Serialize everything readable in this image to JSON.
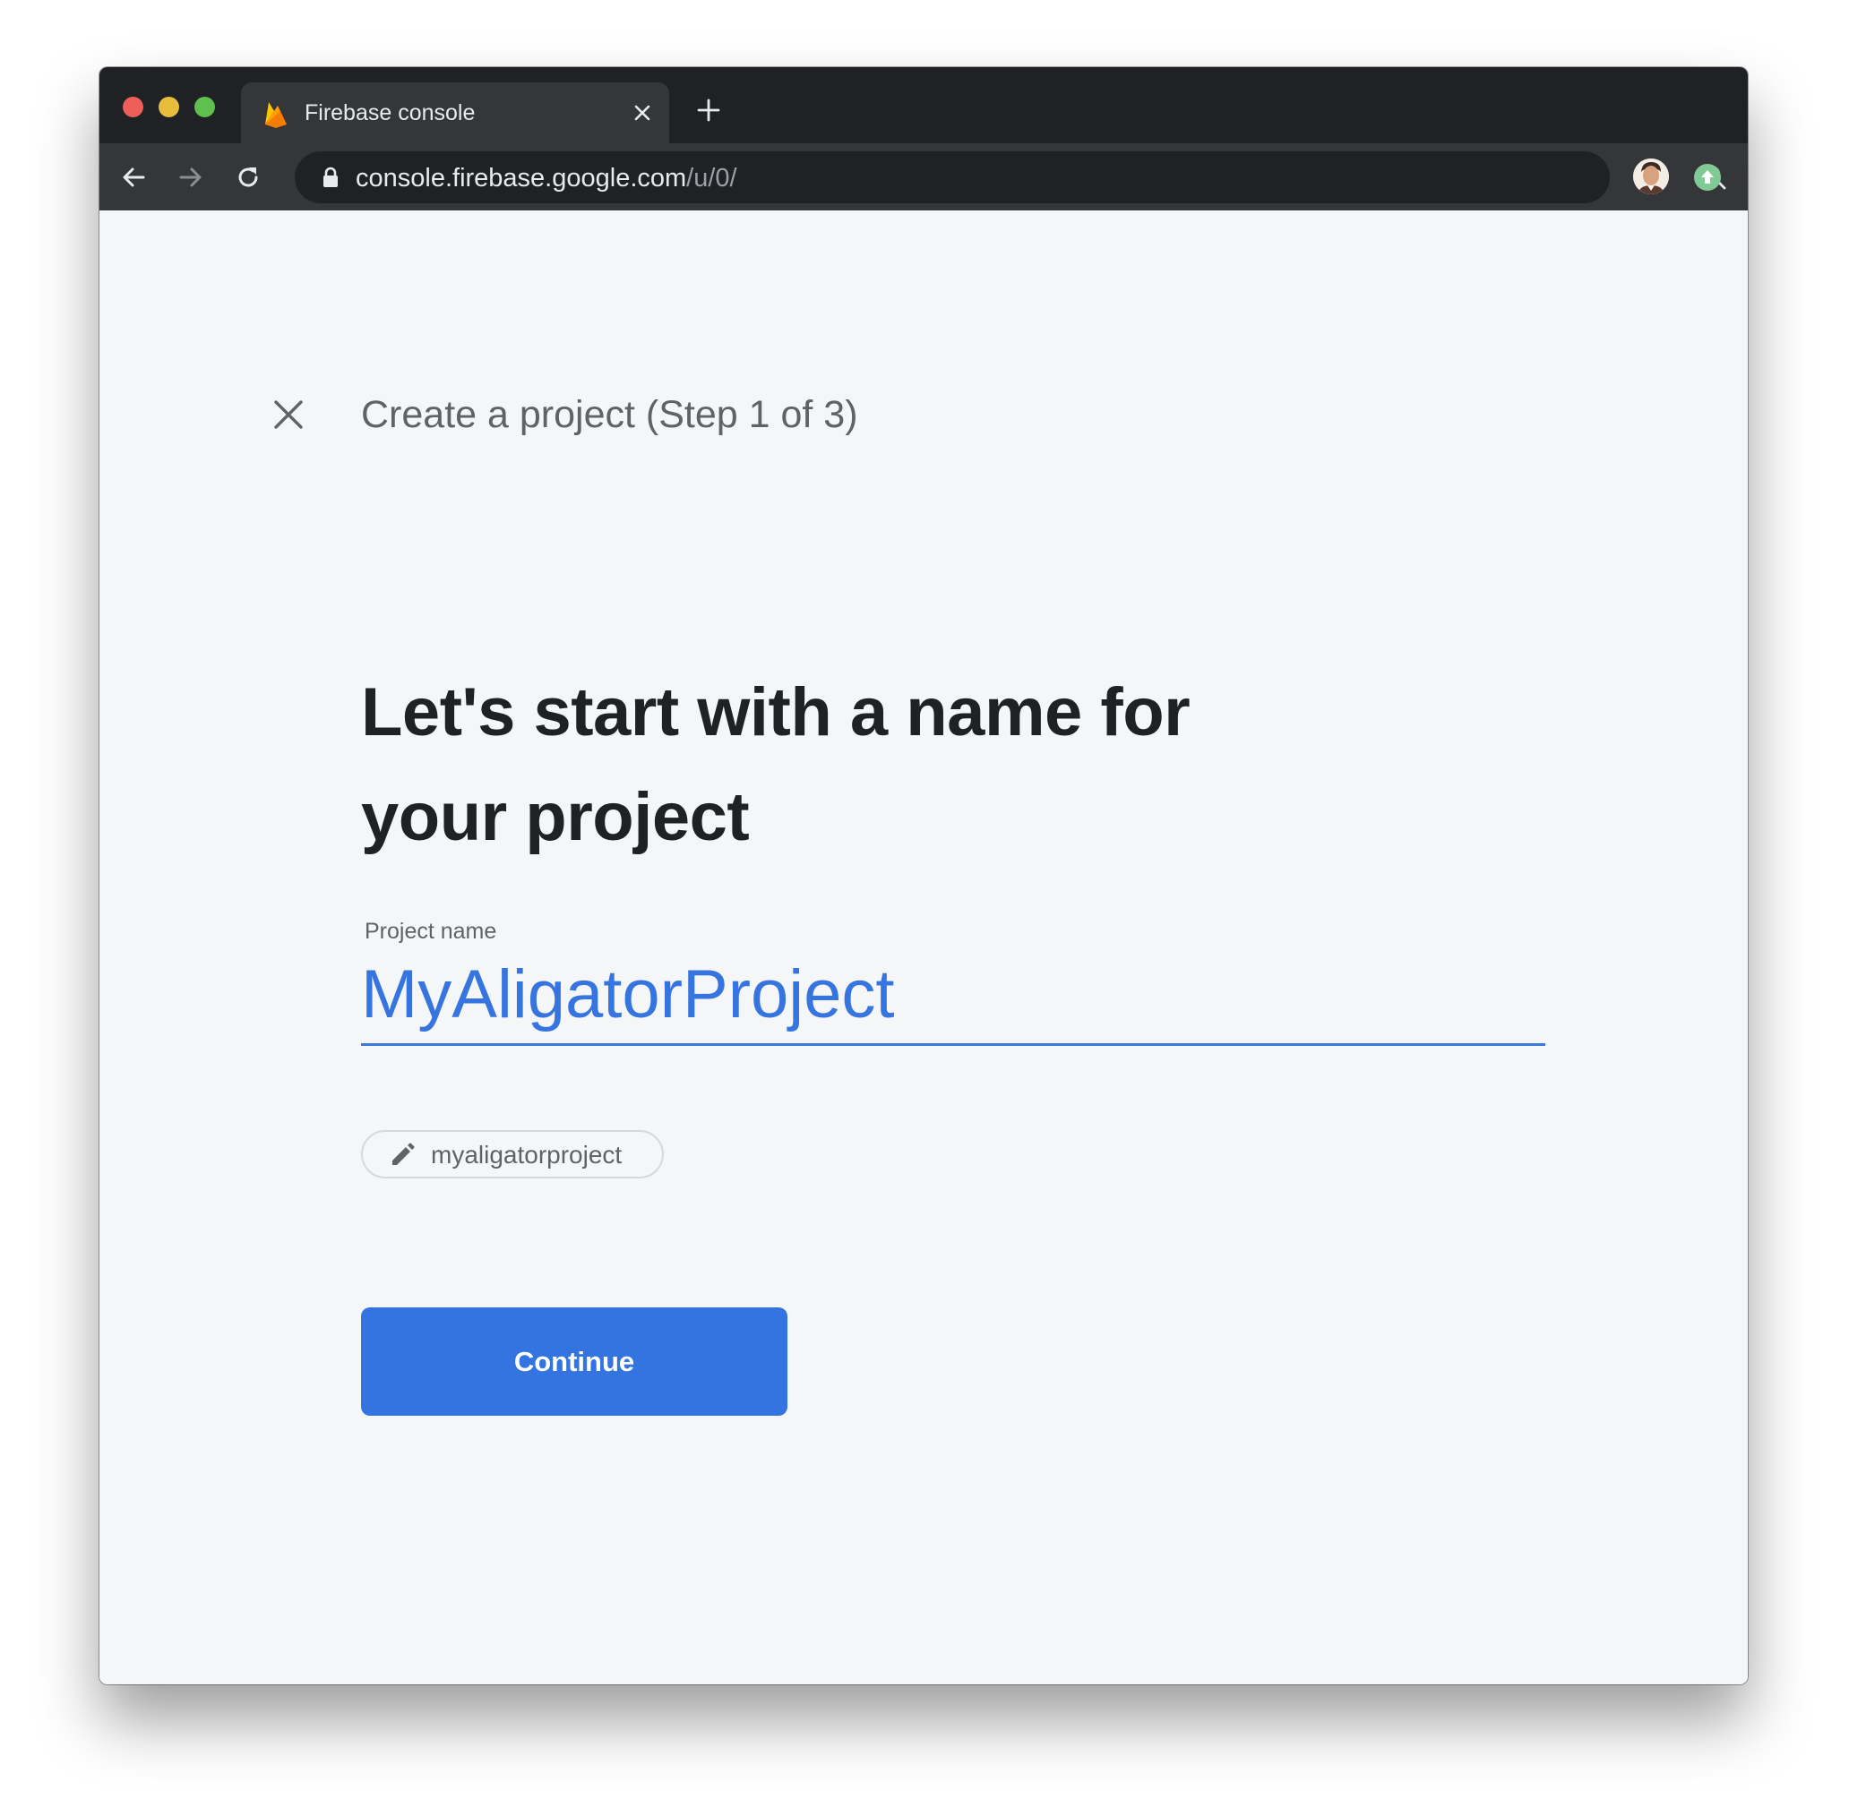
{
  "browser": {
    "tab_title": "Firebase console",
    "url_host": "console.firebase.google.com",
    "url_path": "/u/0/",
    "accent_colors": {
      "close": "#ed5f58",
      "minimize": "#e6be3c",
      "maximize": "#5fc14d"
    }
  },
  "page": {
    "step_title": "Create a project (Step 1 of 3)",
    "headline": "Let's start with a name for your project",
    "field_label": "Project name",
    "project_name_value": "MyAligatorProject",
    "project_id": "myaligatorproject",
    "continue_label": "Continue",
    "accent_color": "#3474e0"
  }
}
